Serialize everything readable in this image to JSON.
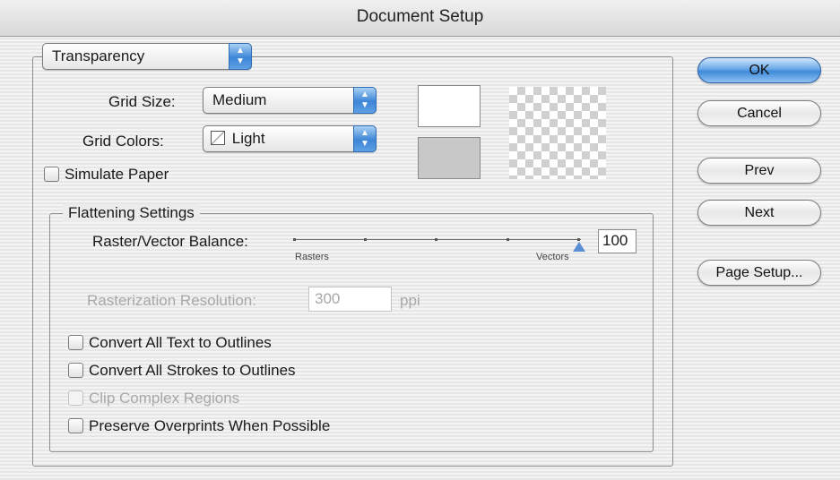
{
  "window": {
    "title": "Document Setup"
  },
  "section_popup": {
    "value": "Transparency"
  },
  "grid_size": {
    "label": "Grid Size:",
    "value": "Medium"
  },
  "grid_colors": {
    "label": "Grid Colors:",
    "value": "Light"
  },
  "simulate_paper": {
    "label": "Simulate Paper",
    "checked": false
  },
  "swatches": {
    "top_color": "#ffffff",
    "bottom_color": "#c8c8c8"
  },
  "flattening": {
    "title": "Flattening Settings",
    "balance_label": "Raster/Vector Balance:",
    "balance_value": "100",
    "min_label": "Rasters",
    "max_label": "Vectors",
    "resolution_label": "Rasterization Resolution:",
    "resolution_value": "300",
    "resolution_unit": "ppi"
  },
  "options": [
    {
      "label": "Convert All Text to Outlines",
      "checked": false,
      "enabled": true
    },
    {
      "label": "Convert All Strokes to Outlines",
      "checked": false,
      "enabled": true
    },
    {
      "label": "Clip Complex Regions",
      "checked": false,
      "enabled": false
    },
    {
      "label": "Preserve Overprints When Possible",
      "checked": false,
      "enabled": true
    }
  ],
  "buttons": {
    "ok": "OK",
    "cancel": "Cancel",
    "prev": "Prev",
    "next": "Next",
    "page_setup": "Page Setup..."
  },
  "colors": {
    "accent": "#3e8ad9"
  }
}
